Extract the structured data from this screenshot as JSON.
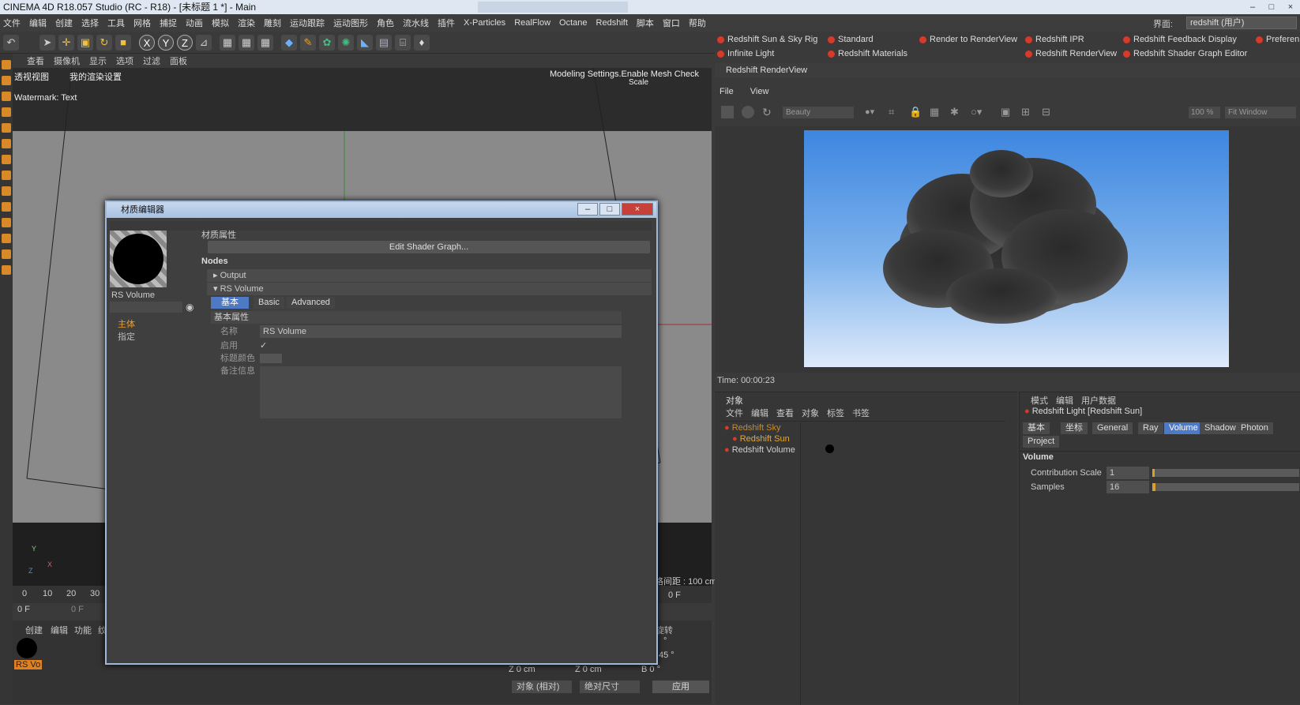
{
  "window": {
    "title": "CINEMA 4D R18.057 Studio (RC - R18) - [未标题 1 *] - Main",
    "min": "–",
    "max": "□",
    "close": "×"
  },
  "menubar": {
    "items": [
      "文件",
      "编辑",
      "创建",
      "选择",
      "工具",
      "网格",
      "捕捉",
      "动画",
      "模拟",
      "渲染",
      "雕刻",
      "运动跟踪",
      "运动图形",
      "角色",
      "流水线",
      "插件",
      "X-Particles",
      "RealFlow",
      "Octane",
      "Redshift",
      "脚本",
      "窗口",
      "帮助"
    ],
    "layout_label": "界面:",
    "layout_value": "redshift (用户)"
  },
  "viewport": {
    "menu": [
      "查看",
      "摄像机",
      "显示",
      "选项",
      "过滤",
      "面板"
    ],
    "camera": "透视视图",
    "render_setting": "我的渲染设置",
    "hud": "Modeling Settings.Enable Mesh Check",
    "hud2": "Scale",
    "watermark": "Watermark: Text",
    "grid_spacing": "网格间距 : 100 cm",
    "axis_y": "Y",
    "axis_x": "X",
    "axis_z": "Z"
  },
  "timeline": {
    "ticks": [
      "0",
      "10",
      "20",
      "30"
    ],
    "start": "0 F",
    "current": "0 F",
    "end": "0 F"
  },
  "material_manager": {
    "menu": [
      "创建",
      "编辑",
      "功能",
      "纹理"
    ],
    "material_name": "RS Vo"
  },
  "coords": {
    "z1": "Z  0 cm",
    "z2": "Z  0 cm",
    "b": "B  0 °",
    "deg1": "°",
    "deg2": "45 °",
    "mode": "对象 (相对)",
    "size": "绝对尺寸",
    "apply": "应用",
    "section": "旋转"
  },
  "shelf": {
    "buttons": [
      "Redshift Sun & Sky Rig",
      "Standard",
      "Render to RenderView",
      "Redshift IPR",
      "Redshift Feedback Display",
      "Preferen",
      "Infinite Light",
      "Redshift Materials",
      "Redshift RenderView",
      "Redshift Shader Graph Editor"
    ]
  },
  "renderview": {
    "title": "Redshift RenderView",
    "menu": [
      "File",
      "View"
    ],
    "aov": "Beauty",
    "zoom": "100 %",
    "fit": "Fit Window",
    "time": "Time: 00:00:23"
  },
  "objects": {
    "title": "对象",
    "menu": [
      "文件",
      "编辑",
      "查看",
      "对象",
      "标签",
      "书签"
    ],
    "items": [
      {
        "name": "Redshift Sky",
        "color": "#c88a2a"
      },
      {
        "name": "Redshift Sun",
        "color": "#e8a830"
      },
      {
        "name": "Redshift Volume",
        "color": "#cfcfcf"
      }
    ]
  },
  "attributes": {
    "menu": [
      "模式",
      "编辑",
      "用户数据"
    ],
    "object": "Redshift Light [Redshift Sun]",
    "tabs": [
      "基本",
      "坐标",
      "General",
      "Ray",
      "Volume",
      "Shadow",
      "Photon",
      "Project"
    ],
    "active_tab": "Volume",
    "section": "Volume",
    "fields": [
      {
        "label": "Contribution Scale",
        "value": "1",
        "fill": 0.0
      },
      {
        "label": "Samples",
        "value": "16",
        "fill": 0.02
      }
    ]
  },
  "material_editor": {
    "title": "材质编辑器",
    "preview_name": "RS Volume",
    "side_items": [
      "主体",
      "指定"
    ],
    "props_title": "材质属性",
    "edit_button": "Edit Shader Graph...",
    "nodes_label": "Nodes",
    "node_output": "Output",
    "node_volume": "RS Volume",
    "tabs": [
      "基本",
      "Basic",
      "Advanced"
    ],
    "active_tab": "基本",
    "basic_props": "基本属性",
    "name_label": "名称",
    "name_value": "RS Volume",
    "enable_label": "启用",
    "enable_check": "✓",
    "color_label": "标题颜色",
    "notes_label": "备注信息"
  }
}
